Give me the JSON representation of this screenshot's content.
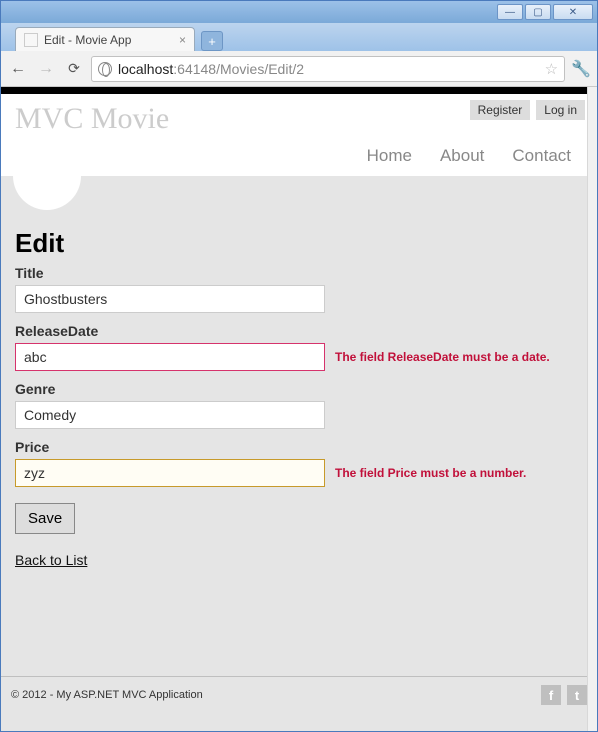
{
  "window": {
    "tab_title": "Edit - Movie App",
    "url_host": "localhost",
    "url_port_path": ":64148/Movies/Edit/2"
  },
  "header": {
    "brand": "MVC Movie",
    "register": "Register",
    "login": "Log in",
    "nav": {
      "home": "Home",
      "about": "About",
      "contact": "Contact"
    }
  },
  "page": {
    "heading": "Edit",
    "labels": {
      "title": "Title",
      "releaseDate": "ReleaseDate",
      "genre": "Genre",
      "price": "Price"
    },
    "values": {
      "title": "Ghostbusters",
      "releaseDate": "abc",
      "genre": "Comedy",
      "price": "zyz"
    },
    "errors": {
      "releaseDate": "The field ReleaseDate must be a date.",
      "price": "The field Price must be a number."
    },
    "save": "Save",
    "back": "Back to List"
  },
  "footer": {
    "copyright": "© 2012 - My ASP.NET MVC Application"
  }
}
